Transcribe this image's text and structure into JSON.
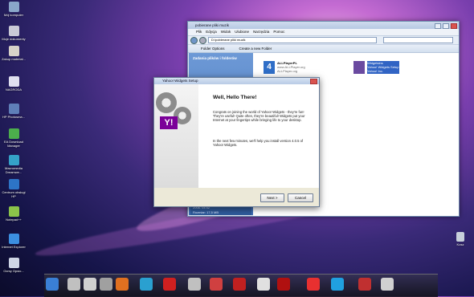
{
  "desktop_icons": [
    {
      "label": "Mój komputer",
      "color": "#8aa7c9"
    },
    {
      "label": "Moje dokumenty",
      "color": "#c9c9d6"
    },
    {
      "label": "Zakup materiał...",
      "color": "#d7d2c8"
    },
    {
      "label": "NAGRODA",
      "color": "#e0e0f0"
    },
    {
      "label": "HP Photosma...",
      "color": "#5f7fb8"
    },
    {
      "label": "EA Download Manager",
      "color": "#4cae4c"
    },
    {
      "label": "Macromedia Dreamwe...",
      "color": "#35a2c8"
    },
    {
      "label": "Centrum obsługi HP",
      "color": "#2d74c6"
    },
    {
      "label": "Notepad++",
      "color": "#8bc34a"
    },
    {
      "label": "Internet Explorer",
      "color": "#3c8fe0"
    },
    {
      "label": "Ocmy Opsio...",
      "color": "#cfd6e6"
    }
  ],
  "right_icon": {
    "label": "Kosz"
  },
  "explorer": {
    "title": "pobierane pliki muzik",
    "menu": [
      "Plik",
      "Edycja",
      "Widok",
      "Ulubione",
      "Narzędzia",
      "Pomoc"
    ],
    "address": "D:\\pobierane pliki muzik",
    "toolbar": [
      "Folder Options",
      "Create a new Folder"
    ],
    "left_pane_header": "Zadania plików i folderów",
    "left_pane_footer": [
      "2006. 04:42",
      "Rozmiar: 17,5 MB"
    ],
    "files": [
      {
        "name": "ALLPlayerPL",
        "sub1": "www.ALLPlayer.org",
        "sub2": "ALLPlayer.org"
      },
      {
        "name": "WidgetsIns",
        "sub1": "Yahoo! Widgets Setup",
        "sub2": "Yahoo! Inc."
      }
    ]
  },
  "dialog": {
    "title": "Yahoo! Widgets Setup",
    "heading": "Well, Hello There!",
    "paragraph1": "Congrats on joining the world of Yahoo! Widgets - they're fun! They're useful! Quite often, they're beautiful! Widgets put your Internet at your fingertips while bringing life to your desktop.",
    "paragraph2": "In the next few minutes, we'll help you install version 4.0.5 of Yahoo! Widgets.",
    "logo": "Y!",
    "next_label": "Next >",
    "cancel_label": "Cancel"
  },
  "dock_colors": [
    "#3a7fd5",
    "#c0c0c0",
    "#d0d0d0",
    "#a0a0a0",
    "#e07020",
    "#2aa0d0",
    "#d02020",
    "#c0c0c0",
    "#d04040",
    "#c02020",
    "#e0e0e0",
    "#b01010",
    "#e83030",
    "#20a0e0",
    "#c03030",
    "#d0d0d0"
  ]
}
